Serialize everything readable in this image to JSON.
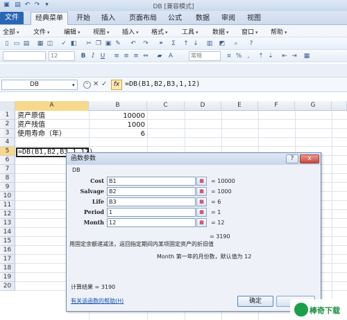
{
  "window": {
    "title": "DB [兼容模式]"
  },
  "ribbon_tabs": [
    "文件",
    "经典菜单",
    "开始",
    "插入",
    "页面布局",
    "公式",
    "数据",
    "审阅",
    "视图"
  ],
  "classic_menu": [
    {
      "label": "全部"
    },
    {
      "label": "文件"
    },
    {
      "label": "编辑"
    },
    {
      "label": "视图"
    },
    {
      "label": "插入"
    },
    {
      "label": "格式"
    },
    {
      "label": "工具"
    },
    {
      "label": "数据"
    },
    {
      "label": "窗口"
    },
    {
      "label": "帮助"
    }
  ],
  "font_size": "12",
  "number_format": "常规",
  "name_box": "DB",
  "formula": "=DB(B1,B2,B3,1,12)",
  "columns": [
    "A",
    "B",
    "C",
    "D",
    "E",
    "F",
    "G"
  ],
  "rows": [
    "1",
    "2",
    "3",
    "4",
    "5",
    "6",
    "7",
    "8",
    "9",
    "10",
    "11",
    "12",
    "13",
    "14",
    "15",
    "16",
    "17",
    "18",
    "19",
    "20"
  ],
  "cells": {
    "a1": "资产原值",
    "b1": "10000",
    "a2": "资产残值",
    "b2": "1000",
    "a3": "使用寿命（年）",
    "b3": "6",
    "a5": "=DB(B1,B2,B3,1,12)"
  },
  "dialog": {
    "title": "函数参数",
    "help_btn": "?",
    "close_btn": "x",
    "function_name": "DB",
    "args": [
      {
        "label": "Cost",
        "value": "B1",
        "result": "= 10000"
      },
      {
        "label": "Salvage",
        "value": "B2",
        "result": "= 1000"
      },
      {
        "label": "Life",
        "value": "B3",
        "result": "= 6"
      },
      {
        "label": "Period",
        "value": "1",
        "result": "= 1"
      },
      {
        "label": "Month",
        "value": "12",
        "result": "= 12"
      }
    ],
    "total": "= 3190",
    "description": "用固定余额递减法，返回指定期间内某项固定资产的折旧值",
    "arg_description": "Month  第一年的月份数，默认值为 12",
    "result": "计算结果 = 3190",
    "help_link": "有关该函数的帮助(H)",
    "ok": "确定"
  },
  "watermark": {
    "text": "棒奇下载"
  },
  "colors": {
    "file_tab": "#2a66b4",
    "selection_header": "#f7d98c",
    "watermark": "#1aa04a"
  }
}
